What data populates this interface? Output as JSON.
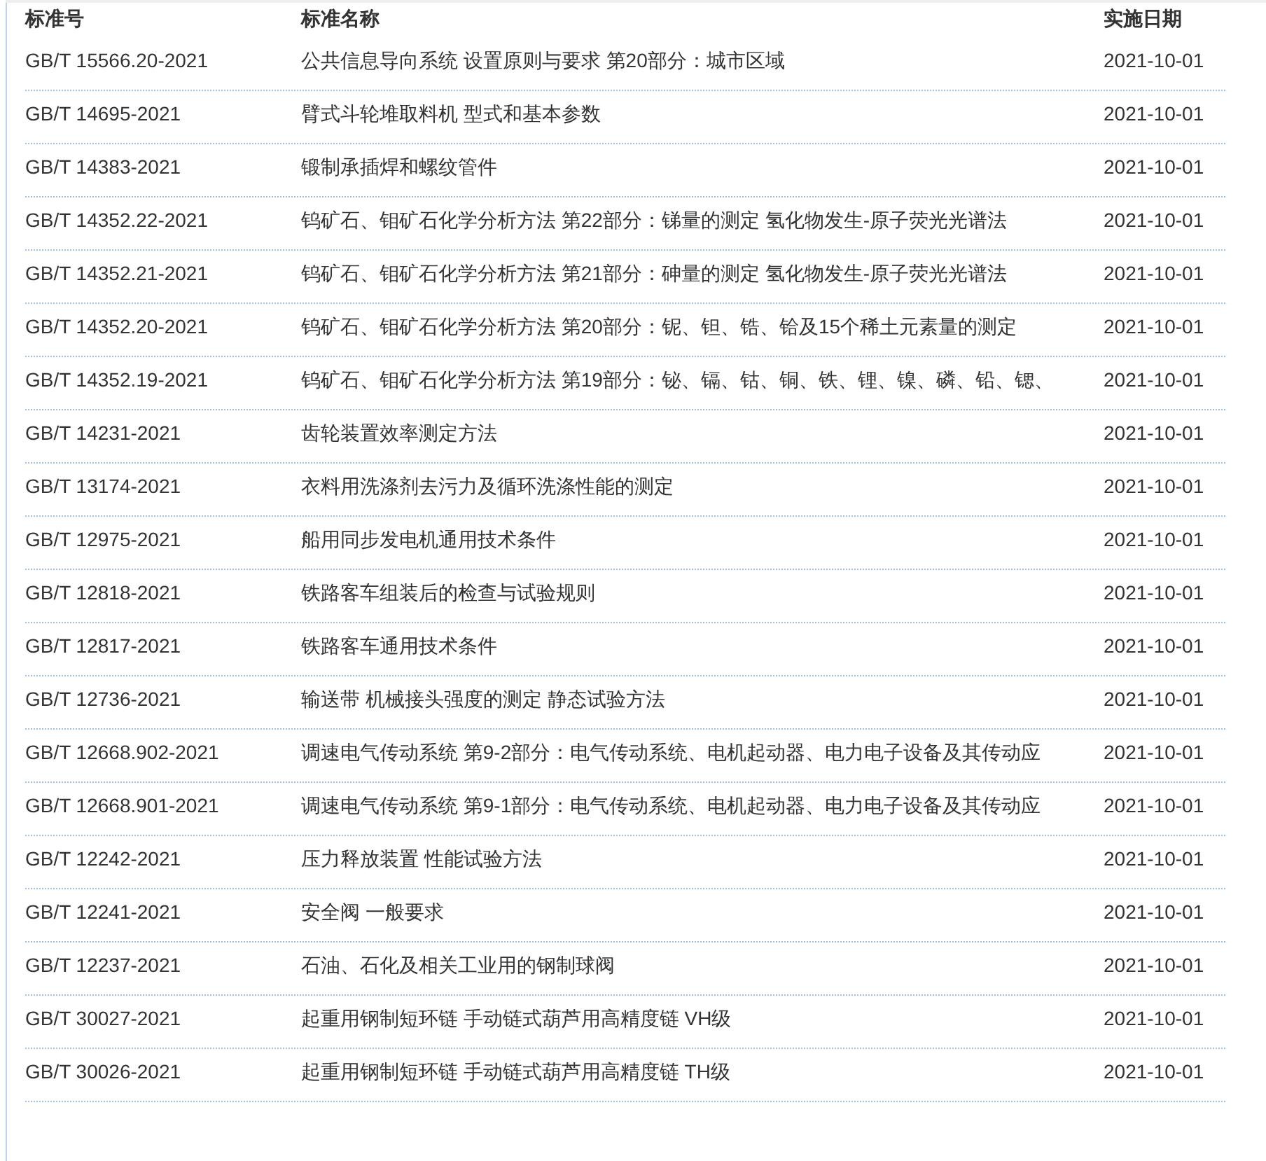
{
  "table": {
    "columns": [
      "标准号",
      "标准名称",
      "实施日期"
    ],
    "rows": [
      {
        "code": "GB/T 15566.20-2021",
        "name": "公共信息导向系统 设置原则与要求 第20部分：城市区域",
        "date": "2021-10-01"
      },
      {
        "code": "GB/T 14695-2021",
        "name": "臂式斗轮堆取料机 型式和基本参数",
        "date": "2021-10-01"
      },
      {
        "code": "GB/T 14383-2021",
        "name": "锻制承插焊和螺纹管件",
        "date": "2021-10-01"
      },
      {
        "code": "GB/T 14352.22-2021",
        "name": "钨矿石、钼矿石化学分析方法 第22部分：锑量的测定 氢化物发生-原子荧光光谱法",
        "date": "2021-10-01"
      },
      {
        "code": "GB/T 14352.21-2021",
        "name": "钨矿石、钼矿石化学分析方法 第21部分：砷量的测定 氢化物发生-原子荧光光谱法",
        "date": "2021-10-01"
      },
      {
        "code": "GB/T 14352.20-2021",
        "name": "钨矿石、钼矿石化学分析方法 第20部分：铌、钽、锆、铪及15个稀土元素量的测定",
        "date": "2021-10-01"
      },
      {
        "code": "GB/T 14352.19-2021",
        "name": "钨矿石、钼矿石化学分析方法 第19部分：铋、镉、钴、铜、铁、锂、镍、磷、铅、锶、",
        "date": "2021-10-01"
      },
      {
        "code": "GB/T 14231-2021",
        "name": "齿轮装置效率测定方法",
        "date": "2021-10-01"
      },
      {
        "code": "GB/T 13174-2021",
        "name": "衣料用洗涤剂去污力及循环洗涤性能的测定",
        "date": "2021-10-01"
      },
      {
        "code": "GB/T 12975-2021",
        "name": "船用同步发电机通用技术条件",
        "date": "2021-10-01"
      },
      {
        "code": "GB/T 12818-2021",
        "name": "铁路客车组装后的检查与试验规则",
        "date": "2021-10-01"
      },
      {
        "code": "GB/T 12817-2021",
        "name": "铁路客车通用技术条件",
        "date": "2021-10-01"
      },
      {
        "code": "GB/T 12736-2021",
        "name": "输送带 机械接头强度的测定 静态试验方法",
        "date": "2021-10-01"
      },
      {
        "code": "GB/T 12668.902-2021",
        "name": "调速电气传动系统 第9-2部分：电气传动系统、电机起动器、电力电子设备及其传动应",
        "date": "2021-10-01"
      },
      {
        "code": "GB/T 12668.901-2021",
        "name": "调速电气传动系统 第9-1部分：电气传动系统、电机起动器、电力电子设备及其传动应",
        "date": "2021-10-01"
      },
      {
        "code": "GB/T 12242-2021",
        "name": "压力释放装置 性能试验方法",
        "date": "2021-10-01"
      },
      {
        "code": "GB/T 12241-2021",
        "name": "安全阀 一般要求",
        "date": "2021-10-01"
      },
      {
        "code": "GB/T 12237-2021",
        "name": "石油、石化及相关工业用的钢制球阀",
        "date": "2021-10-01"
      },
      {
        "code": "GB/T 30027-2021",
        "name": "起重用钢制短环链 手动链式葫芦用高精度链 VH级",
        "date": "2021-10-01"
      },
      {
        "code": "GB/T 30026-2021",
        "name": "起重用钢制短环链 手动链式葫芦用高精度链 TH级",
        "date": "2021-10-01"
      }
    ]
  }
}
